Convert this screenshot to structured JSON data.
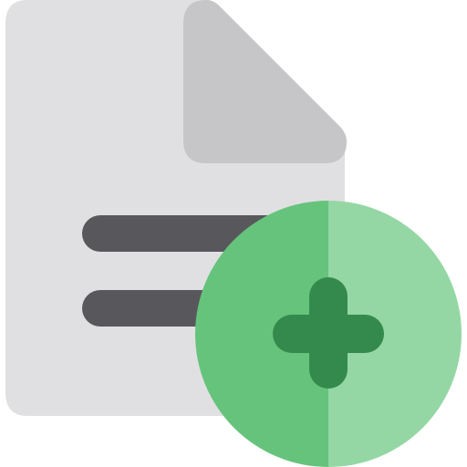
{
  "icon": {
    "name": "add-file-icon",
    "colors": {
      "page": "#e0e0e2",
      "fold": "#c6c6c8",
      "text_lines": "#58585c",
      "badge_left": "#66c37b",
      "badge_right": "#94d7a4",
      "plus": "#348a4c"
    }
  }
}
